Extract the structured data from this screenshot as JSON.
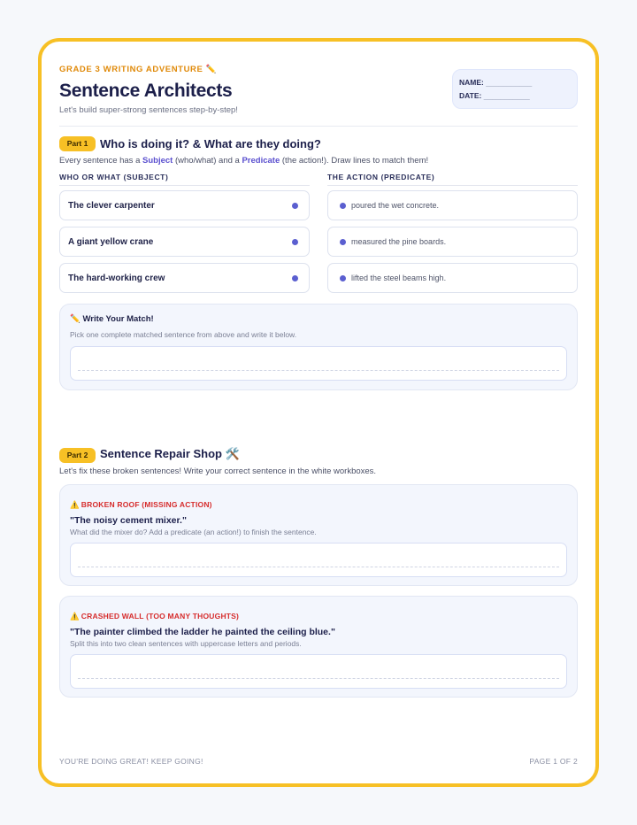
{
  "header": {
    "kicker": "GRADE 3 WRITING ADVENTURE ✏️",
    "title": "Sentence Architects",
    "subtitle": "Let's build super-strong sentences step-by-step!",
    "name_label": "NAME:",
    "name_line": "___________",
    "date_label": "DATE:",
    "date_line": "___________"
  },
  "part1": {
    "badge": "Part 1",
    "heading": "Who is doing it? & What are they doing?",
    "desc_pre": "Every sentence has a ",
    "desc_subject": "Subject",
    "desc_mid": " (who/what) and a ",
    "desc_predicate": "Predicate",
    "desc_post": " (the action!). Draw lines to match them!",
    "col_subject": "WHO OR WHAT (SUBJECT)",
    "col_predicate": "THE ACTION (PREDICATE)",
    "subjects": [
      "The clever carpenter",
      "A giant yellow crane",
      "The hard-working crew"
    ],
    "predicates": [
      "poured the wet concrete.",
      "measured the pine boards.",
      "lifted the steel beams high."
    ],
    "write_title": "✏️ Write Your Match!",
    "write_sub": "Pick one complete matched sentence from above and write it below."
  },
  "part2": {
    "badge": "Part 2",
    "heading": "Sentence Repair Shop 🛠️",
    "desc": "Let's fix these broken sentences! Write your correct sentence in the white workboxes.",
    "items": [
      {
        "icon": "⚠️",
        "label": "BROKEN ROOF (MISSING ACTION)",
        "quote": "\"The noisy cement mixer.\"",
        "hint": "What did the mixer do? Add a predicate (an action!) to finish the sentence."
      },
      {
        "icon": "⚠️",
        "label": "CRASHED WALL (TOO MANY THOUGHTS)",
        "quote": "\"The painter climbed the ladder he painted the ceiling blue.\"",
        "hint": "Split this into two clean sentences with uppercase letters and periods."
      }
    ]
  },
  "footer": {
    "left": "YOU'RE DOING GREAT! KEEP GOING!",
    "right": "PAGE 1 OF 2"
  },
  "colors": {
    "border": "#f7c025",
    "accent": "#5a4fcf",
    "warn": "#d62c2c",
    "kicker": "#e08a0a"
  }
}
